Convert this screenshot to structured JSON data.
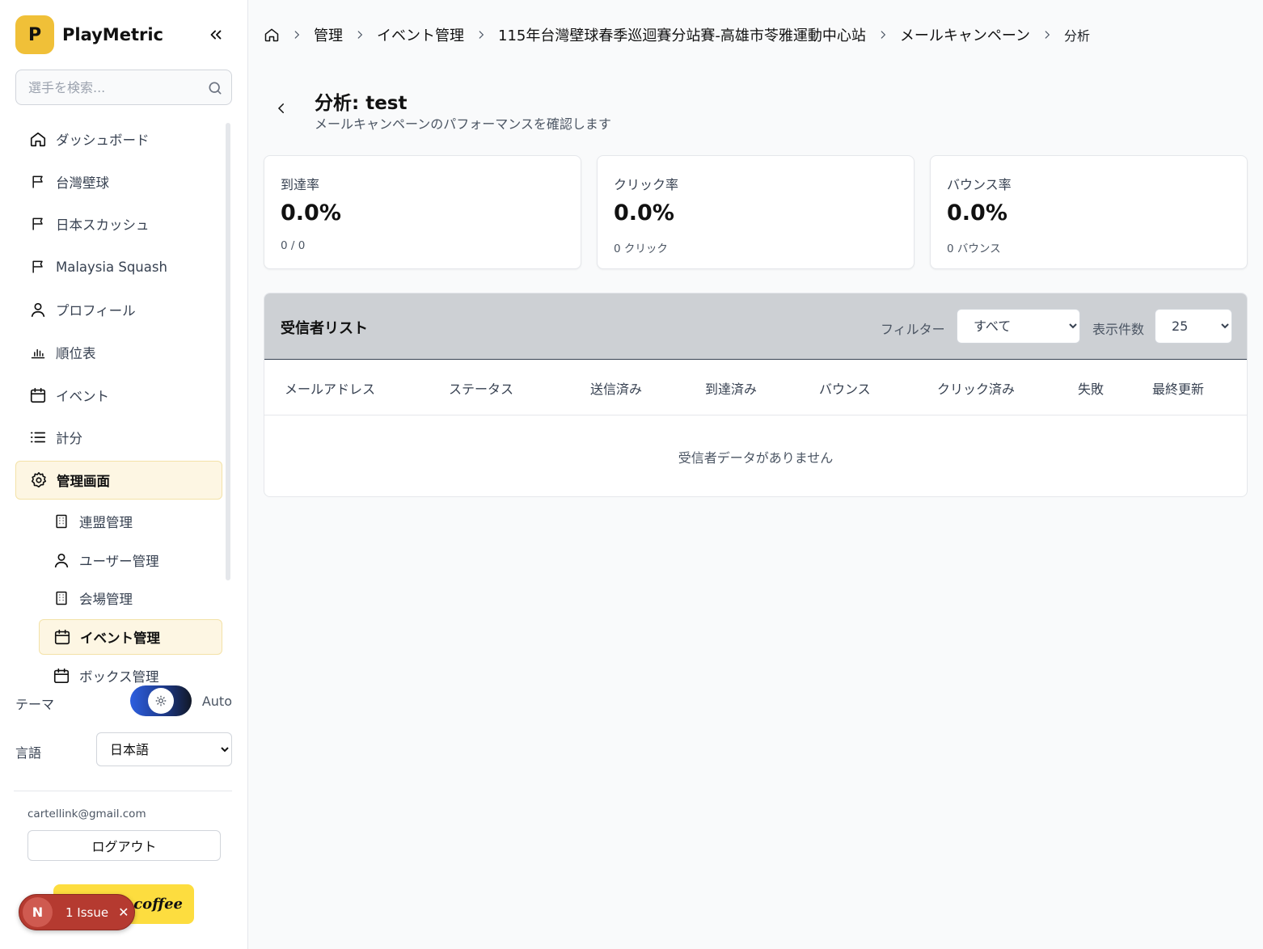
{
  "brand": {
    "logo_letter": "P",
    "name": "PlayMetric"
  },
  "search": {
    "placeholder": "選手を検索..."
  },
  "nav": {
    "items": [
      {
        "label": "ダッシュボード",
        "icon": "home-icon"
      },
      {
        "label": "台灣壁球",
        "icon": "flag-icon"
      },
      {
        "label": "日本スカッシュ",
        "icon": "flag-icon"
      },
      {
        "label": "Malaysia Squash",
        "icon": "flag-icon"
      },
      {
        "label": "プロフィール",
        "icon": "user-icon"
      },
      {
        "label": "順位表",
        "icon": "bar-chart-icon"
      },
      {
        "label": "イベント",
        "icon": "calendar-icon"
      },
      {
        "label": "計分",
        "icon": "list-icon"
      },
      {
        "label": "管理画面",
        "icon": "gear-icon",
        "active": true
      }
    ],
    "sub_items": [
      {
        "label": "連盟管理",
        "icon": "building-icon"
      },
      {
        "label": "ユーザー管理",
        "icon": "user-icon"
      },
      {
        "label": "会場管理",
        "icon": "building-icon"
      },
      {
        "label": "イベント管理",
        "icon": "calendar-icon",
        "active": true
      },
      {
        "label": "ボックス管理",
        "icon": "calendar-icon"
      }
    ]
  },
  "theme": {
    "label": "テーマ",
    "mode": "Auto",
    "icon": "sun-icon"
  },
  "language": {
    "label": "言語",
    "selected": "日本語"
  },
  "user": {
    "email": "cartellink@gmail.com",
    "logout_label": "ログアウト"
  },
  "coffee": {
    "label": "a coffee"
  },
  "issue_badge": {
    "letter": "N",
    "text": "1 Issue",
    "close": "✕"
  },
  "breadcrumb": {
    "items": [
      "管理",
      "イベント管理",
      "115年台灣壁球春季巡迴賽分站賽-高雄市苓雅運動中心站",
      "メールキャンペーン"
    ],
    "current": "分析"
  },
  "page": {
    "title": "分析: test",
    "subtitle": "メールキャンペーンのパフォーマンスを確認します"
  },
  "stats": [
    {
      "label": "到達率",
      "value": "0.0%",
      "sub": "0 / 0"
    },
    {
      "label": "クリック率",
      "value": "0.0%",
      "sub": "0 クリック"
    },
    {
      "label": "バウンス率",
      "value": "0.0%",
      "sub": "0 バウンス"
    }
  ],
  "recipients": {
    "title": "受信者リスト",
    "filter_label": "フィルター",
    "filter_selected": "すべて",
    "count_label": "表示件数",
    "count_selected": "25",
    "columns": [
      "メールアドレス",
      "ステータス",
      "送信済み",
      "到達済み",
      "バウンス",
      "クリック済み",
      "失敗",
      "最終更新"
    ],
    "empty_message": "受信者データがありません"
  },
  "colors": {
    "accent": "#f0c038",
    "active_bg": "#fdf6e3",
    "issue_red": "#b53a30",
    "coffee_yellow": "#fddd3f"
  }
}
